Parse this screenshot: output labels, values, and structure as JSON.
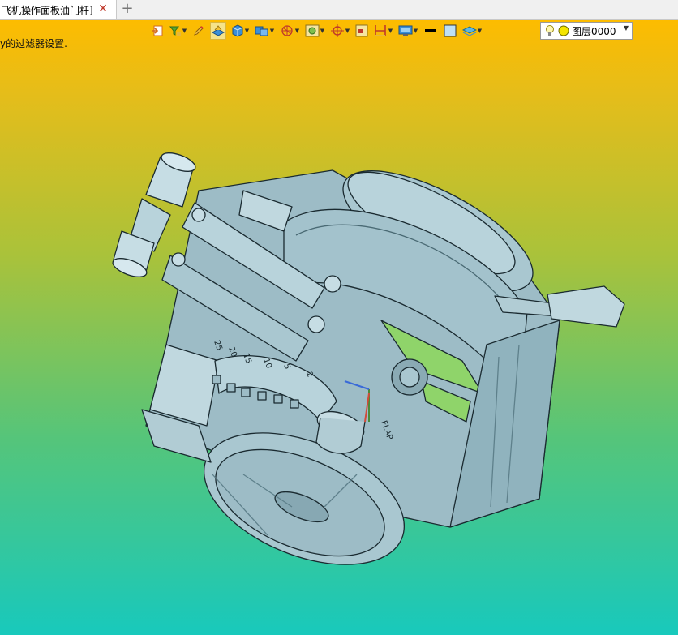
{
  "tab": {
    "title": "飞机操作面板油门杆]",
    "close_glyph": "✕",
    "add_glyph": "+"
  },
  "viewport": {
    "status_text": "y的过滤器设置."
  },
  "toolbar": {
    "icons": [
      {
        "name": "import-icon",
        "has_dropdown": false
      },
      {
        "name": "filter-icon",
        "has_dropdown": true
      },
      {
        "name": "pencil-icon",
        "has_dropdown": false
      },
      {
        "name": "shaded-view-icon",
        "has_dropdown": false,
        "selected": true
      },
      {
        "name": "cube-view-icon",
        "has_dropdown": true
      },
      {
        "name": "render-mode-icon",
        "has_dropdown": true
      },
      {
        "name": "section-icon",
        "has_dropdown": true
      },
      {
        "name": "zoom-fit-icon",
        "has_dropdown": true
      },
      {
        "name": "target-icon",
        "has_dropdown": true
      },
      {
        "name": "select-box-icon",
        "has_dropdown": false
      },
      {
        "name": "measure-icon",
        "has_dropdown": true
      },
      {
        "name": "display-icon",
        "has_dropdown": true
      },
      {
        "name": "line-color-icon",
        "has_dropdown": false
      },
      {
        "name": "fill-color-icon",
        "has_dropdown": false
      },
      {
        "name": "layers-icon",
        "has_dropdown": true
      }
    ],
    "layer": {
      "label": "图层0000",
      "dropdown_glyph": "▼"
    }
  },
  "colors": {
    "model_body": "#a9c7d0",
    "model_edge": "#1a2a30",
    "model_shadow": "#7fa3ae",
    "accent_green": "#8fd46a"
  },
  "model": {
    "gear_labels": [
      "2",
      "5",
      "10",
      "15",
      "20",
      "25"
    ],
    "flap_label": "FLAP"
  }
}
